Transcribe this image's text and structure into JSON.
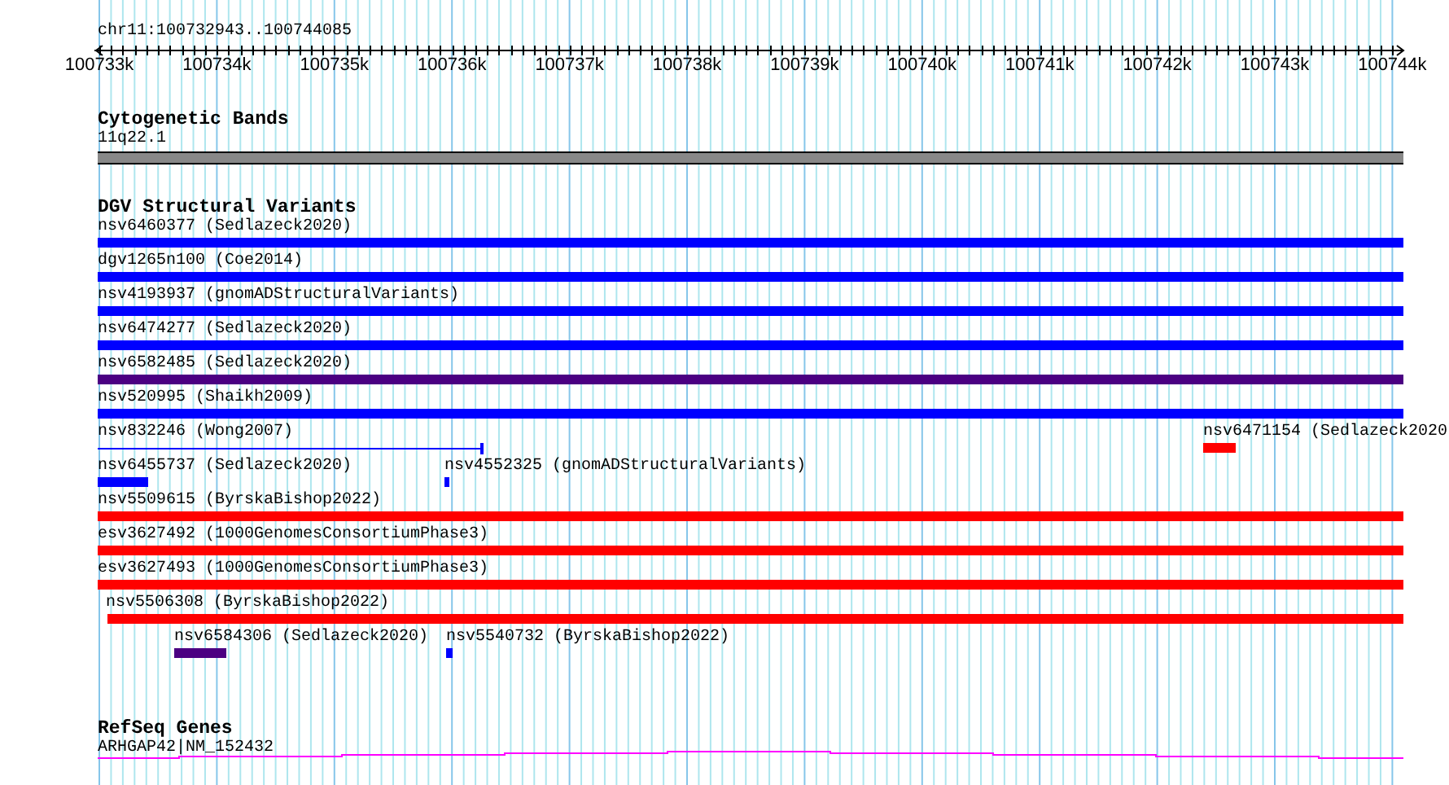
{
  "ruler": {
    "location": "chr11:100732943..100744085",
    "ticks": [
      "100733k",
      "100734k",
      "100735k",
      "100736k",
      "100737k",
      "100738k",
      "100739k",
      "100740k",
      "100741k",
      "100742k",
      "100743k",
      "100744k"
    ]
  },
  "tracks": [
    {
      "kind": "bands",
      "title": "Cytogenetic Bands",
      "rows": [
        [
          {
            "label": "11q22.1",
            "kind": "bar",
            "color": "#888888"
          }
        ]
      ]
    },
    {
      "kind": "variants",
      "title": "DGV Structural Variants",
      "rows": [
        [
          {
            "label": "nsv6460377 (Sedlazeck2020)",
            "kind": "bar",
            "color": "#0000ff"
          }
        ],
        [
          {
            "label": "dgv1265n100 (Coe2014)",
            "kind": "bar",
            "color": "#0000ff"
          }
        ],
        [
          {
            "label": "nsv4193937 (gnomADStructuralVariants)",
            "kind": "bar",
            "color": "#0000ff"
          }
        ],
        [
          {
            "label": "nsv6474277 (Sedlazeck2020)",
            "kind": "bar",
            "color": "#0000ff"
          }
        ],
        [
          {
            "label": "nsv6582485 (Sedlazeck2020)",
            "kind": "bar",
            "color": "#4b0082"
          }
        ],
        [
          {
            "label": "nsv520995 (Shaikh2009)",
            "kind": "bar",
            "color": "#0000ff"
          }
        ],
        [
          {
            "label": "nsv832246 (Wong2007)",
            "kind": "line",
            "color": "#0000ff"
          },
          {
            "label": "nsv6471154 (Sedlazeck2020",
            "kind": "bar",
            "color": "#ff0000"
          }
        ],
        [
          {
            "label": "nsv6455737 (Sedlazeck2020)",
            "kind": "bar",
            "color": "#0000ff"
          },
          {
            "label": "nsv4552325 (gnomADStructuralVariants)",
            "kind": "bar",
            "color": "#0000ff"
          }
        ],
        [
          {
            "label": "nsv5509615 (ByrskaBishop2022)",
            "kind": "bar",
            "color": "#ff0000"
          }
        ],
        [
          {
            "label": "esv3627492 (1000GenomesConsortiumPhase3)",
            "kind": "bar",
            "color": "#ff0000"
          }
        ],
        [
          {
            "label": "esv3627493 (1000GenomesConsortiumPhase3)",
            "kind": "bar",
            "color": "#ff0000"
          }
        ],
        [
          {
            "label": "nsv5506308 (ByrskaBishop2022)",
            "kind": "bar",
            "color": "#ff0000"
          }
        ],
        [
          {
            "label": "nsv6584306 (Sedlazeck2020)",
            "kind": "bar",
            "color": "#4b0082"
          },
          {
            "label": "nsv5540732 (ByrskaBishop2022)",
            "kind": "bar",
            "color": "#0000ff"
          }
        ]
      ]
    },
    {
      "kind": "genes",
      "title": "RefSeq Genes",
      "rows": [
        [
          {
            "label": "ARHGAP42|NM_152432",
            "kind": "gene",
            "color": "#ff00ff"
          }
        ]
      ]
    }
  ]
}
